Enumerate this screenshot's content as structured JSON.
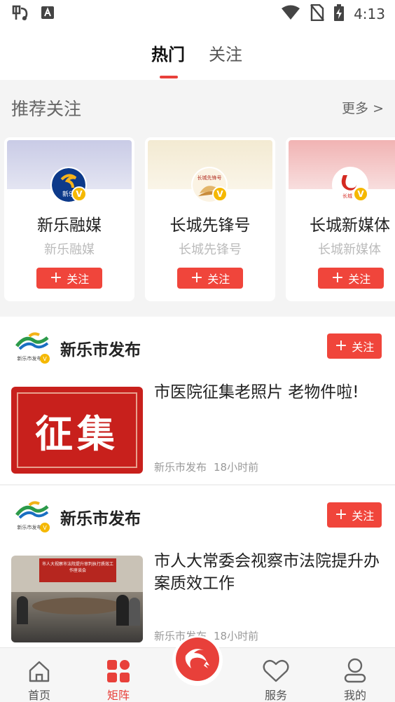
{
  "status_bar": {
    "time": "4:13",
    "left_icons": [
      "app-notification-icon",
      "accessibility-icon"
    ],
    "right_icons": [
      "wifi-icon",
      "no-sim-icon",
      "battery-charging-icon"
    ]
  },
  "top_tabs": [
    {
      "label": "热门",
      "active": true
    },
    {
      "label": "关注",
      "active": false
    }
  ],
  "recommend": {
    "title": "推荐关注",
    "more": "更多 >",
    "cards": [
      {
        "name": "新乐融媒",
        "subtitle": "新乐融媒",
        "follow": "关注",
        "avatar_text": "新乐",
        "verified": "V"
      },
      {
        "name": "长城先锋号",
        "subtitle": "长城先锋号",
        "follow": "关注",
        "avatar_text": "长城先锋号",
        "verified": "V"
      },
      {
        "name": "长城新媒体",
        "subtitle": "长城新媒体",
        "follow": "关注",
        "avatar_text": "长城",
        "verified": "V"
      }
    ]
  },
  "feed": [
    {
      "source": "新乐市发布",
      "follow": "关注",
      "logo_text": "新乐市发布",
      "verified": "V",
      "headline": "市医院征集老照片 老物件啦!",
      "thumb_text": "征集",
      "meta_source": "新乐市发布",
      "meta_time": "18小时前"
    },
    {
      "source": "新乐市发布",
      "follow": "关注",
      "logo_text": "新乐市发布",
      "verified": "V",
      "headline": "市人大常委会视察市法院提升办案质效工作",
      "thumb_text": "市人大视察市法院提升审判执行质效工作座谈会",
      "meta_source": "新乐市发布",
      "meta_time": "18小时前"
    }
  ],
  "bottom_nav": [
    {
      "label": "首页",
      "icon": "home-icon",
      "active": false
    },
    {
      "label": "矩阵",
      "icon": "grid-icon",
      "active": true
    },
    {
      "label": "",
      "icon": "center-logo-icon",
      "active": false
    },
    {
      "label": "服务",
      "icon": "heart-icon",
      "active": false
    },
    {
      "label": "我的",
      "icon": "profile-icon",
      "active": false
    }
  ],
  "colors": {
    "accent": "#e8403a",
    "follow_button": "#f0453b",
    "verified_badge": "#f5b800",
    "section_bg": "#f4f4f4"
  }
}
